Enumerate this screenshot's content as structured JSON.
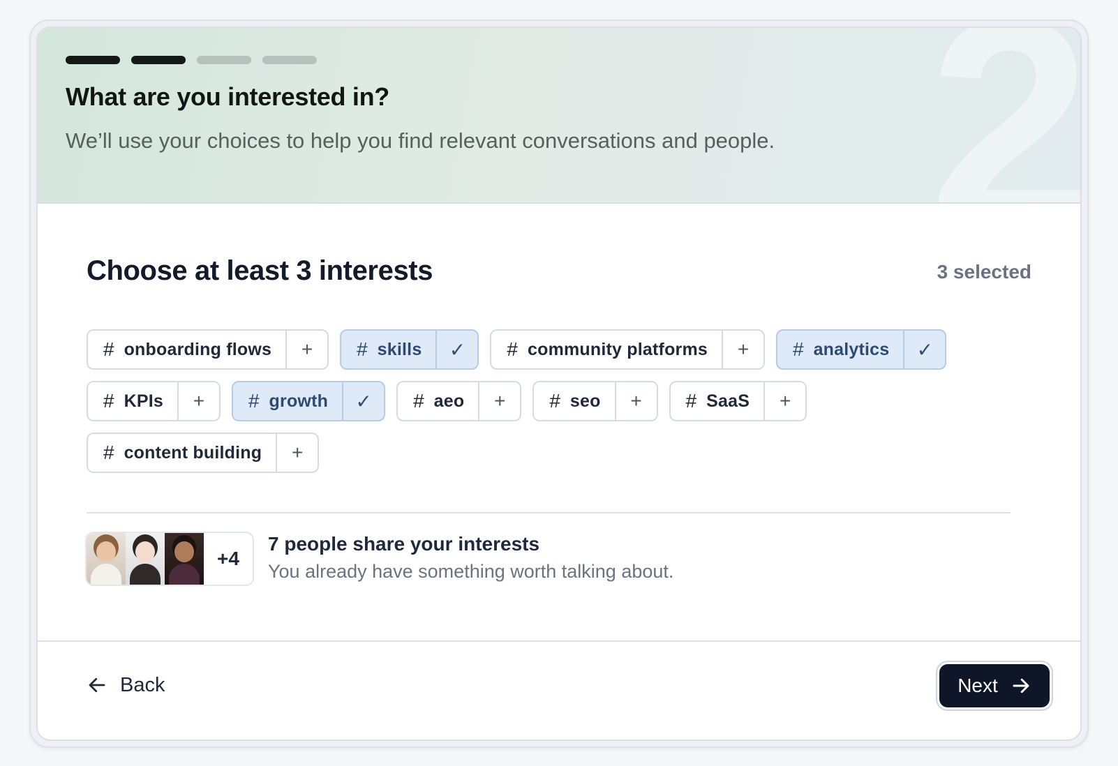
{
  "header": {
    "step_number": "2",
    "progress": {
      "total_steps": 4,
      "completed_steps": 2
    },
    "title": "What are you interested in?",
    "subtitle": "We’ll use your choices to help you find relevant conversations and people."
  },
  "interests": {
    "heading": "Choose at least 3 interests",
    "selected_count": "3 selected",
    "hash_symbol": "#",
    "add_symbol": "+",
    "check_symbol": "✓",
    "chips": [
      {
        "label": "onboarding flows",
        "selected": false
      },
      {
        "label": "skills",
        "selected": true
      },
      {
        "label": "community platforms",
        "selected": false
      },
      {
        "label": "analytics",
        "selected": true
      },
      {
        "label": "KPIs",
        "selected": false
      },
      {
        "label": "growth",
        "selected": true
      },
      {
        "label": "aeo",
        "selected": false
      },
      {
        "label": "seo",
        "selected": false
      },
      {
        "label": "SaaS",
        "selected": false
      },
      {
        "label": "content building",
        "selected": false
      }
    ]
  },
  "people": {
    "more_count": "+4",
    "title": "7 people share your interests",
    "subtitle": "You already have something worth talking about."
  },
  "footer": {
    "back_label": "Back",
    "next_label": "Next"
  },
  "colors": {
    "accent_dark": "#0e1628",
    "chip_selected_bg": "#dfeaf8",
    "chip_selected_border": "#b6cbe6",
    "progress_done": "#141816",
    "progress_todo": "#b6c2bd"
  }
}
